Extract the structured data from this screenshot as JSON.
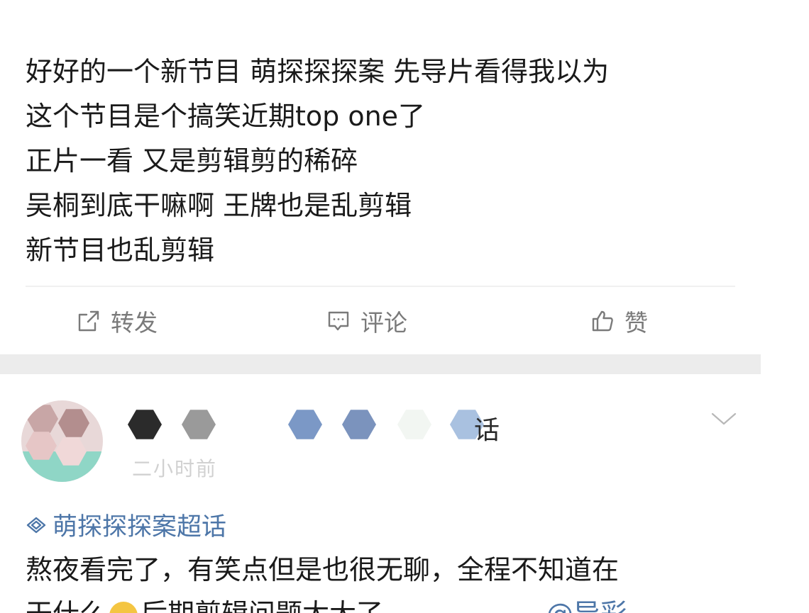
{
  "post": {
    "lines": [
      "好好的一个新节目 萌探探探案 先导片看得我以为",
      "这个节目是个搞笑近期top one了",
      "正片一看 又是剪辑剪的稀碎",
      "吴桐到底干嘛啊 王牌也是乱剪辑",
      "新节目也乱剪辑"
    ]
  },
  "actions": {
    "repost_label": "转发",
    "comment_label": "评论",
    "like_label": "赞",
    "repost_icon": "repost-icon",
    "comment_icon": "comment-icon",
    "like_icon": "thumbs-up-icon"
  },
  "reply": {
    "username_visible_tail": "话",
    "time_text": "二小时前",
    "topic": "萌探探探案超话",
    "text_line1": "熬夜看完了，有笑点但是也很无聊，全程不知道在",
    "text_line2": "干什么",
    "text_line2_after_emoji": "后期剪辑问题太大了",
    "mention": "@导彩",
    "colors": {
      "link": "#4d76a8",
      "action_gray": "#7a7a7a",
      "separator": "#ececec"
    }
  }
}
